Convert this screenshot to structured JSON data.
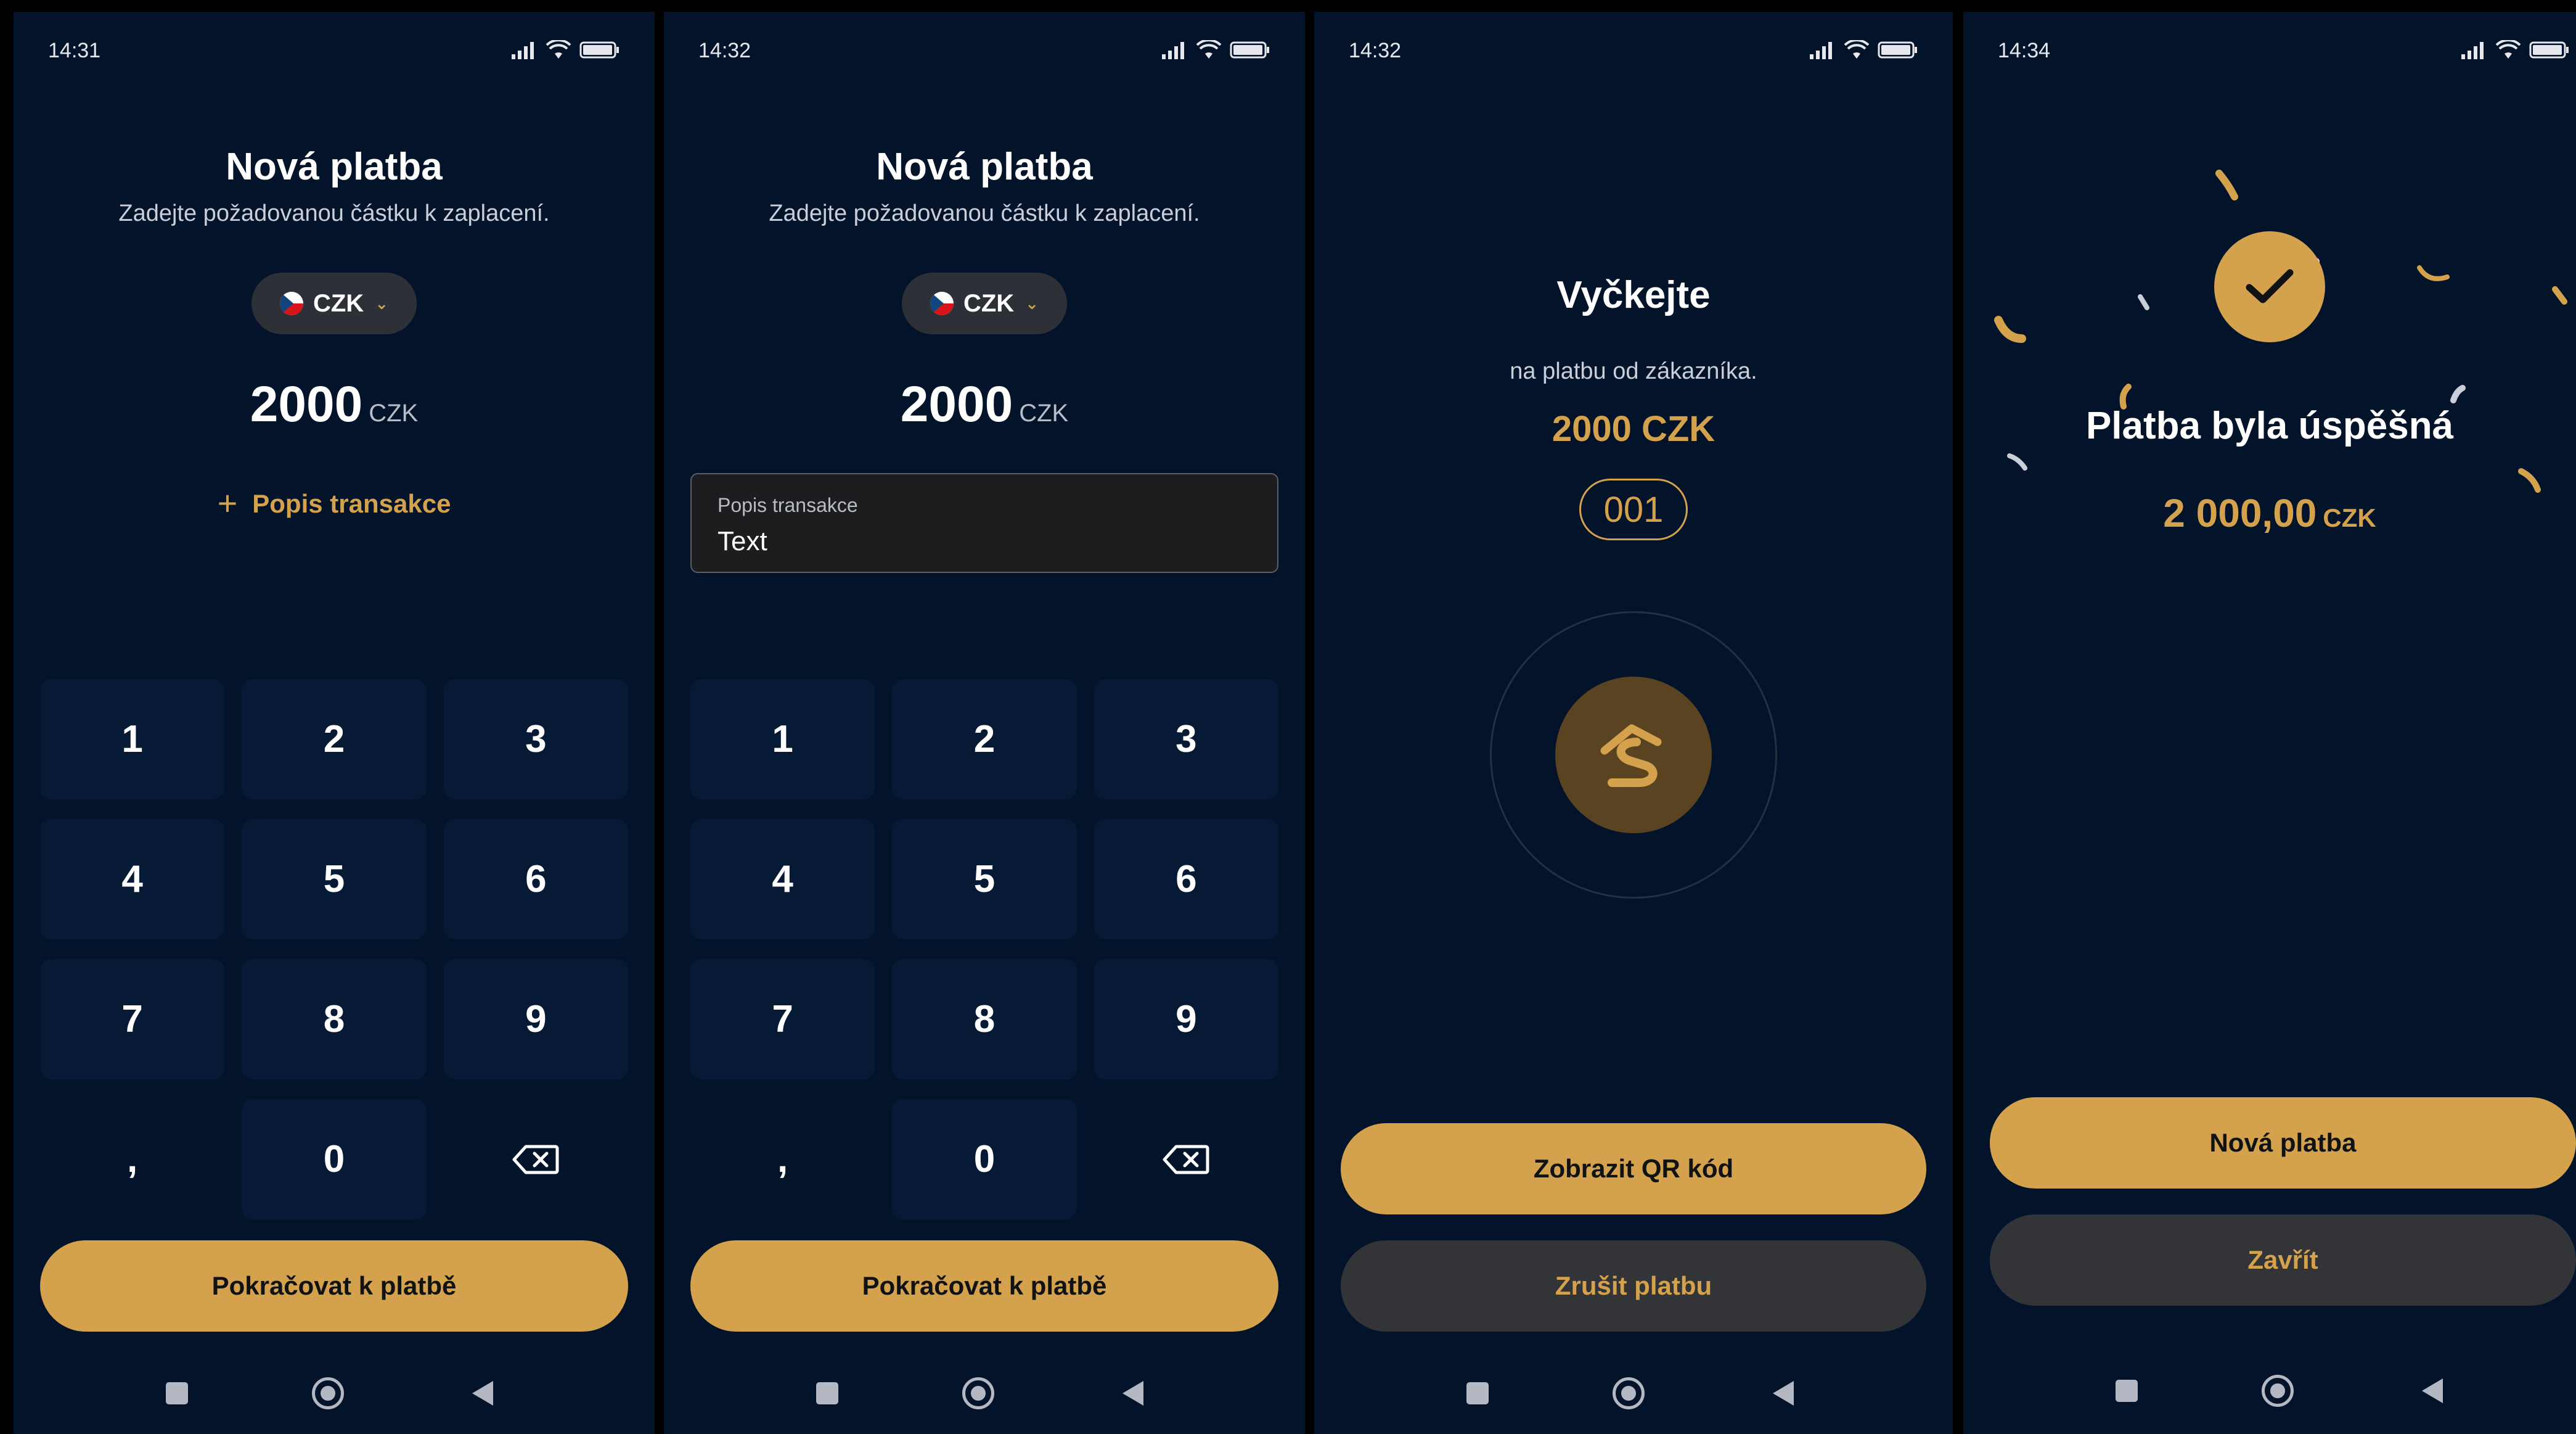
{
  "screens": [
    {
      "time": "14:31",
      "battery": "84",
      "title": "Nová platba",
      "subtitle": "Zadejte požadovanou částku k zaplacení.",
      "currency": "CZK",
      "amount": "2000",
      "amount_currency": "CZK",
      "add_description_label": "Popis transakce",
      "keys": [
        "1",
        "2",
        "3",
        "4",
        "5",
        "6",
        "7",
        "8",
        "9",
        ",",
        "0"
      ],
      "continue_label": "Pokračovat k platbě"
    },
    {
      "time": "14:32",
      "battery": "84",
      "title": "Nová platba",
      "subtitle": "Zadejte požadovanou částku k zaplacení.",
      "currency": "CZK",
      "amount": "2000",
      "amount_currency": "CZK",
      "description_field": {
        "label": "Popis transakce",
        "value": "Text"
      },
      "keys": [
        "1",
        "2",
        "3",
        "4",
        "5",
        "6",
        "7",
        "8",
        "9",
        ",",
        "0"
      ],
      "continue_label": "Pokračovat k platbě"
    },
    {
      "time": "14:32",
      "battery": "84",
      "title": "Vyčkejte",
      "subtitle": "na platbu od zákazníka.",
      "amount": "2000 CZK",
      "code": "001",
      "show_qr_label": "Zobrazit QR kód",
      "cancel_label": "Zrušit platbu"
    },
    {
      "time": "14:34",
      "battery": "84",
      "title": "Platba byla úspěšná",
      "amount": "2 000,00",
      "amount_currency": "CZK",
      "new_payment_label": "Nová platba",
      "close_label": "Zavřít"
    }
  ],
  "colors": {
    "background": "#03132a",
    "accent": "#d4a24c",
    "key_bg": "#061a36",
    "dark_button": "#333438"
  },
  "icons": [
    "signal-icon",
    "wifi-icon",
    "battery-icon",
    "czech-flag-icon",
    "chevron-down-icon",
    "plus-icon",
    "backspace-icon",
    "brand-logo-icon",
    "checkmark-icon",
    "nav-recents-icon",
    "nav-home-icon",
    "nav-back-icon"
  ]
}
